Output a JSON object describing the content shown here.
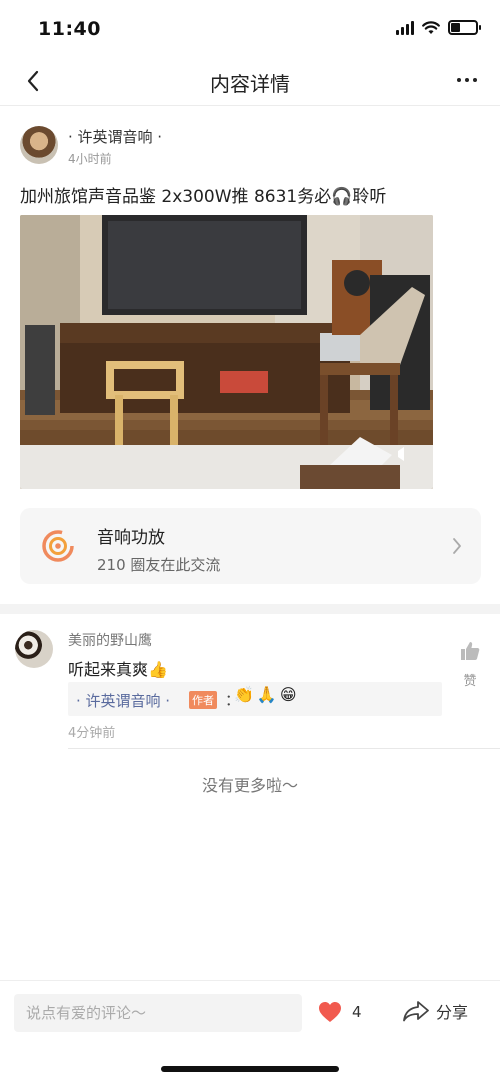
{
  "status_bar": {
    "time": "11:40",
    "battery_level": 0.35
  },
  "nav": {
    "title": "内容详情",
    "back_icon": "chevron-left-icon",
    "more_icon": "more-dots-icon"
  },
  "post": {
    "author": "· 许英谓音响 ·",
    "time": "4小时前",
    "text": "加州旅馆声音品鉴 2x300W推 8631务必🎧聆听"
  },
  "circle": {
    "name": "音响功放",
    "subtitle": "210 圈友在此交流"
  },
  "comment": {
    "author": "美丽的野山鹰",
    "text": "听起来真爽👍",
    "like_label": "赞",
    "time": "4分钟前",
    "reply": {
      "author": "· 许英谓音响 ·",
      "tag": "作者",
      "colon": "：",
      "emojis": [
        "👏",
        "🙏",
        "😁"
      ]
    }
  },
  "footer_note": "没有更多啦～",
  "bottom_bar": {
    "input_placeholder": "说点有爱的评论～",
    "like_count": "4",
    "share_label": "分享"
  },
  "colors": {
    "accent": "#f08a5d",
    "heart": "#f15a4f",
    "reply_author": "#5a6b9e"
  }
}
